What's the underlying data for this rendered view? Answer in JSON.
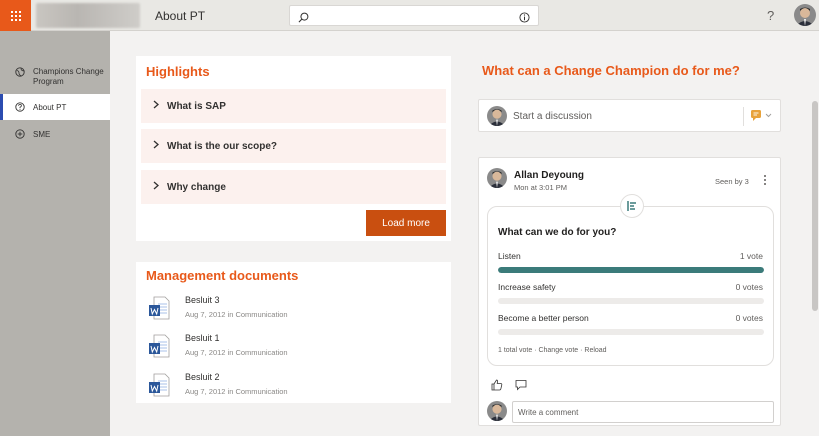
{
  "header": {
    "site_title": "About PT",
    "search": {
      "value": "",
      "placeholder": ""
    },
    "help_label": "?"
  },
  "nav": {
    "items": [
      {
        "label": "Champions Change Program",
        "icon": "globe-icon"
      },
      {
        "label": "About PT",
        "icon": "question-circle-icon",
        "selected": true
      },
      {
        "label": "SME",
        "icon": "plus-circle-icon"
      }
    ]
  },
  "highlights": {
    "title": "Highlights",
    "items": [
      {
        "label": "What is SAP"
      },
      {
        "label": "What is the our scope?"
      },
      {
        "label": "Why change"
      }
    ],
    "load_more_label": "Load more"
  },
  "management_documents": {
    "title": "Management documents",
    "docs": [
      {
        "name": "Besluit 3",
        "meta": "Aug 7, 2012 in Communication"
      },
      {
        "name": "Besluit 1",
        "meta": "Aug 7, 2012 in Communication"
      },
      {
        "name": "Besluit 2",
        "meta": "Aug 7, 2012 in Communication"
      }
    ]
  },
  "champion": {
    "title": "What can a Change Champion do for me?",
    "discussion_placeholder": "Start a discussion",
    "post": {
      "author": "Allan Deyoung",
      "time": "Mon at 3:01 PM",
      "seen": "Seen by 3",
      "poll": {
        "question": "What can we do for you?",
        "options": [
          {
            "label": "Listen",
            "votes": "1 vote",
            "fraction": 1.0
          },
          {
            "label": "Increase safety",
            "votes": "0 votes",
            "fraction": 0
          },
          {
            "label": "Become a better person",
            "votes": "0 votes",
            "fraction": 0
          }
        ],
        "footer": "1 total vote · Change vote · Reload"
      },
      "comment_placeholder": "Write a comment"
    }
  },
  "colors": {
    "accent": "#e8591a",
    "button": "#c94f10",
    "poll_fill": "#3b7b7a",
    "nav_selected_border": "#2b4cb0"
  }
}
